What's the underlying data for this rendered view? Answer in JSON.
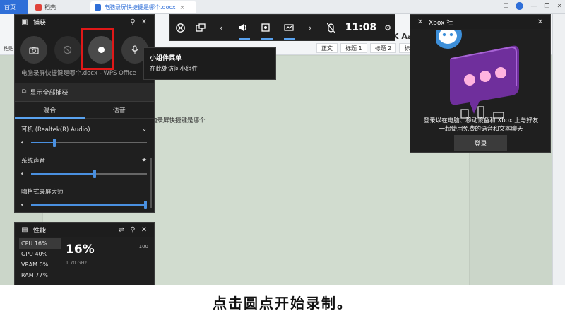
{
  "wps": {
    "tabs": [
      "首页",
      "稻壳",
      "电脑录屏快捷键是哪个.docx"
    ],
    "paste_label": "粘贴",
    "font_sample": "K Aa",
    "styles": [
      "正文",
      "标题 1",
      "标题 2",
      "标题"
    ],
    "doc_text": "脑录屏快捷键是哪个"
  },
  "gamebar": {
    "time": "11:08",
    "icons": [
      "xbox-icon",
      "widget-menu-icon",
      "chevron-left-icon",
      "volume-icon",
      "capture-icon",
      "performance-icon",
      "chevron-right-icon",
      "mouse-lock-icon",
      "settings-icon"
    ]
  },
  "capture": {
    "title": "捕获",
    "target": "电脑录屏快捷键是哪个.docx - WPS Office",
    "show_all": "显示全部捕获"
  },
  "audio": {
    "tabs": [
      "混合",
      "语音"
    ],
    "device": "耳机 (Realtek(R) Audio)",
    "apps": [
      {
        "name": "系统声音",
        "level": 0.55
      },
      {
        "name": "嗨格式录屏大师",
        "level": 1.0
      }
    ],
    "device_level": 0.2
  },
  "performance": {
    "title": "性能",
    "items": [
      {
        "label": "CPU",
        "value": "16%"
      },
      {
        "label": "GPU",
        "value": "40%"
      },
      {
        "label": "VRAM",
        "value": "0%"
      },
      {
        "label": "RAM",
        "value": "77%"
      }
    ],
    "big_value": "16%",
    "sub_value": "1.70 GHz",
    "max": "100"
  },
  "tooltip": {
    "title": "小组件菜单",
    "desc": "在此处访问小组件"
  },
  "xbox": {
    "title": "Xbox 社",
    "message_line1": "登录以在电脑、移动设备和 Xbox 上与好友",
    "message_line2": "一起使用免费的语音和文本聊天",
    "login_label": "登录"
  },
  "caption": "点击圆点开始录制。",
  "colors": {
    "accent": "#4a90e0",
    "highlight": "#e01818",
    "bubble": "#7a3bb0"
  }
}
